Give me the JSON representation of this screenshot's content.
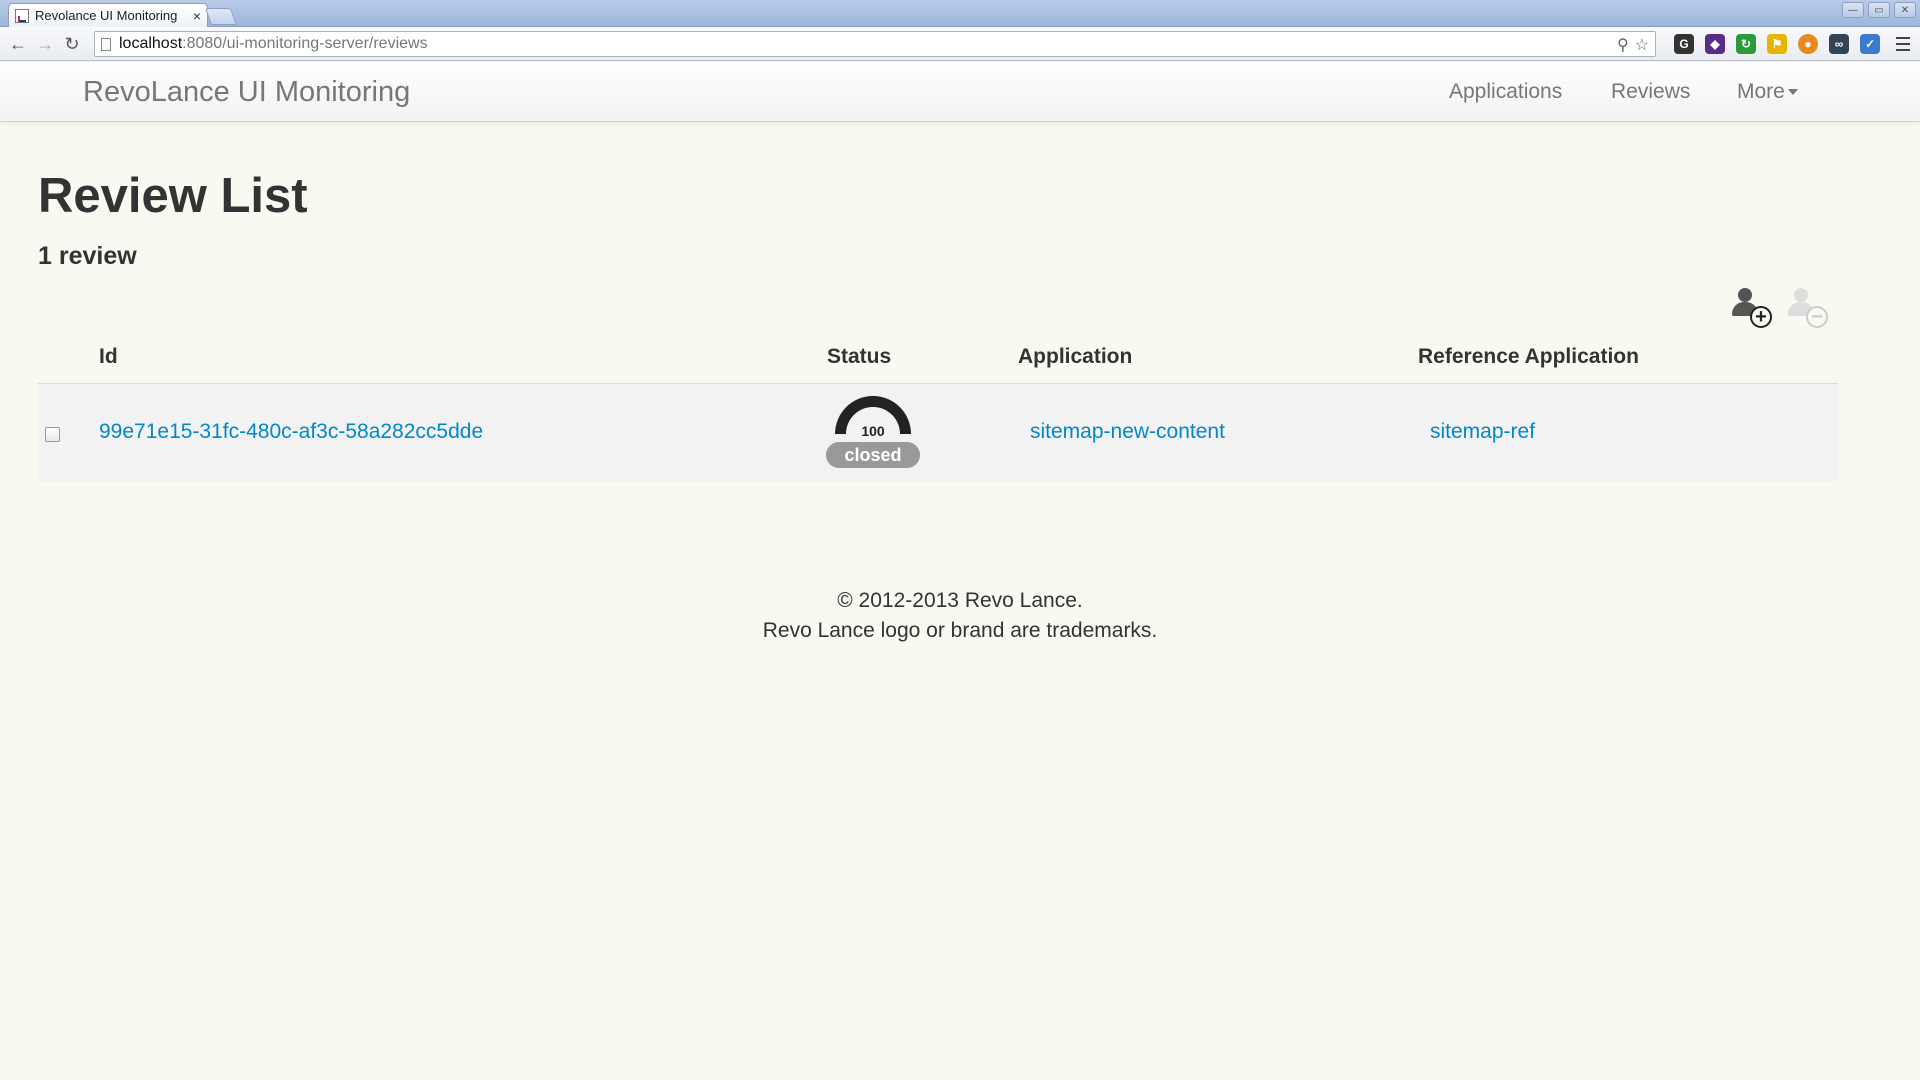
{
  "browser": {
    "tab_title": "Revolance UI Monitoring",
    "tab_close": "×",
    "url_host": "localhost",
    "url_rest": ":8080/ui-monitoring-server/reviews",
    "back": "←",
    "forward": "→",
    "reload": "↻",
    "zoom_icon": "⚲",
    "star_icon": "☆"
  },
  "navbar": {
    "brand": "RevoLance UI Monitoring",
    "applications": "Applications",
    "reviews": "Reviews",
    "more": "More"
  },
  "page": {
    "title": "Review List",
    "count": "1 review"
  },
  "actions": {
    "add_symbol": "+",
    "remove_symbol": "−"
  },
  "table": {
    "headers": {
      "id": "Id",
      "status": "Status",
      "application": "Application",
      "reference": "Reference Application"
    },
    "rows": [
      {
        "id": "99e71e15-31fc-480c-af3c-58a282cc5dde",
        "progress": "100",
        "status": "closed",
        "application": "sitemap-new-content",
        "reference": "sitemap-ref"
      }
    ]
  },
  "footer": {
    "copyright": "© 2012-2013 Revo Lance.",
    "trademark": "Revo Lance logo or brand are trademarks."
  },
  "colors": {
    "link": "#0088cc",
    "background": "#f9f8f1",
    "row": "#f2f2f2",
    "status_pill": "#999999"
  }
}
